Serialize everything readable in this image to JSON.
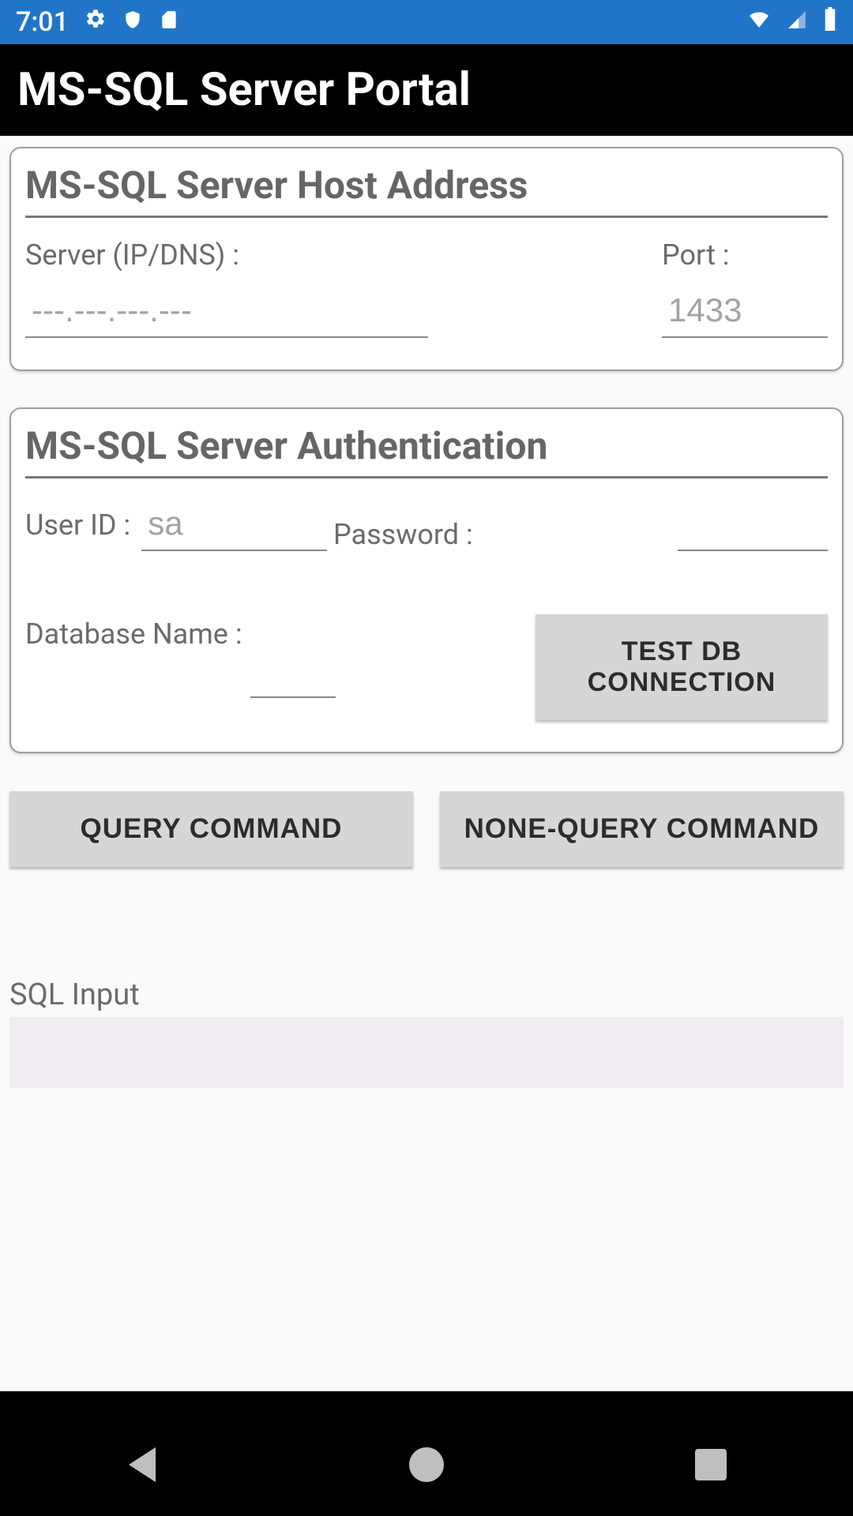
{
  "status": {
    "time": "7:01",
    "icons_left": [
      "gear-icon",
      "shield-icon",
      "sd-card-icon"
    ],
    "icons_right": [
      "wifi-icon",
      "cell-signal-icon",
      "battery-icon"
    ]
  },
  "app": {
    "title": "MS-SQL Server Portal"
  },
  "host_card": {
    "title": "MS-SQL Server Host Address",
    "server_label": "Server (IP/DNS) :",
    "server_placeholder": "---.---.---.---",
    "server_value": "",
    "port_label": "Port :",
    "port_placeholder": "1433",
    "port_value": ""
  },
  "auth_card": {
    "title": "MS-SQL Server Authentication",
    "user_label": "User ID :",
    "user_placeholder": "sa",
    "user_value": "",
    "password_label": "Password :",
    "password_value": "",
    "dbname_label": "Database Name :",
    "dbname_value": "",
    "test_button": "TEST DB CONNECTION"
  },
  "commands": {
    "query_button": "QUERY COMMAND",
    "nonquery_button": "NONE-QUERY COMMAND"
  },
  "sql": {
    "label": "SQL Input"
  }
}
